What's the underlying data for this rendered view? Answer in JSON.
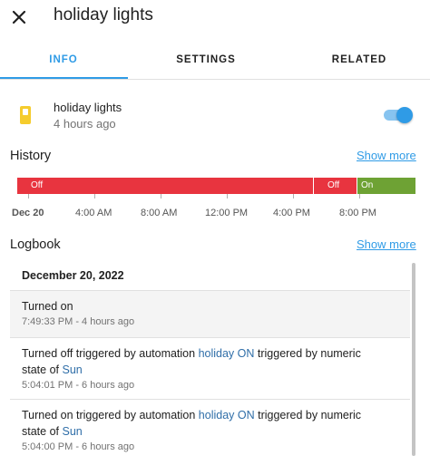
{
  "header": {
    "title": "holiday lights",
    "close_icon": "close-icon"
  },
  "tabs": [
    {
      "label": "INFO",
      "active": true
    },
    {
      "label": "SETTINGS",
      "active": false
    },
    {
      "label": "RELATED",
      "active": false
    }
  ],
  "entity": {
    "name": "holiday lights",
    "last_changed": "4 hours ago",
    "icon": "switch-icon",
    "state_on": true
  },
  "history": {
    "title": "History",
    "show_more": "Show more",
    "segments": [
      {
        "label": "Off",
        "color": "#e8343f"
      },
      {
        "label": "Off",
        "color": "#e8343f"
      },
      {
        "label": "On",
        "color": "#6ea234"
      }
    ],
    "ticks": [
      "Dec 20",
      "4:00 AM",
      "8:00 AM",
      "12:00 PM",
      "4:00 PM",
      "8:00 PM"
    ]
  },
  "logbook": {
    "title": "Logbook",
    "show_more": "Show more",
    "date": "December 20, 2022",
    "entries": [
      {
        "message": "Turned on",
        "time": "7:49:33 PM - 4 hours ago"
      },
      {
        "msg_pre": "Turned off triggered by automation ",
        "msg_link1": "holiday ON",
        "msg_mid": " triggered by numeric state of ",
        "msg_link2": "Sun",
        "time": "5:04:01 PM - 6 hours ago"
      },
      {
        "msg_pre": "Turned on triggered by automation ",
        "msg_link1": "holiday ON",
        "msg_mid": " triggered by numeric state of ",
        "msg_link2": "Sun",
        "time": "5:04:00 PM - 6 hours ago"
      }
    ]
  },
  "colors": {
    "accent": "#2f9be6",
    "off": "#e8343f",
    "on": "#6ea234",
    "icon": "#f5cc2d"
  }
}
